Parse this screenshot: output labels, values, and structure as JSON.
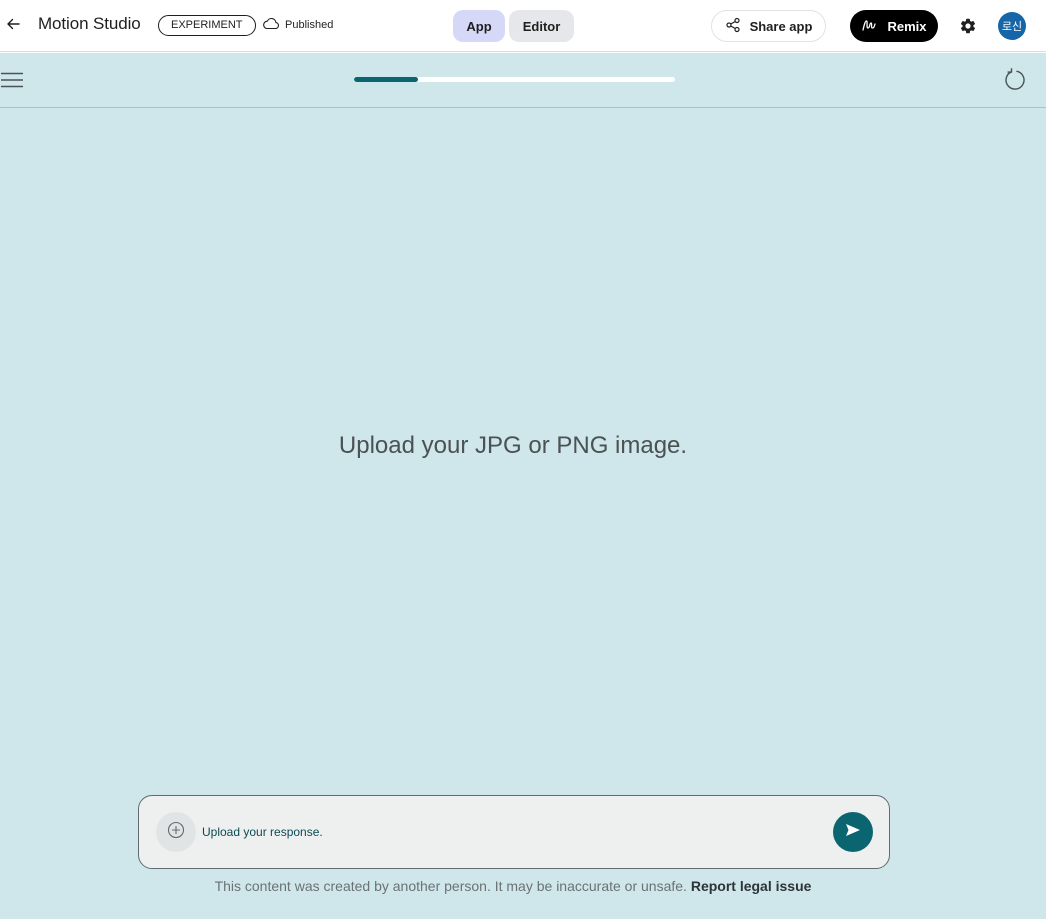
{
  "header": {
    "title": "Motion Studio",
    "badge": "EXPERIMENT",
    "status": "Published",
    "tabs": [
      {
        "label": "App",
        "active": true
      },
      {
        "label": "Editor",
        "active": false
      }
    ],
    "share_label": "Share app",
    "remix_label": "Remix",
    "avatar_initials": "로신",
    "avatar_color": "#1565a8"
  },
  "app": {
    "progress_fraction": 0.2,
    "prompt": "Upload your JPG or PNG image.",
    "accent_color": "#0b6571",
    "background_color": "#cfe6eb"
  },
  "composer": {
    "placeholder": "Upload your response."
  },
  "footer": {
    "disclaimer": "This content was created by another person. It may be inaccurate or unsafe.",
    "report_label": "Report legal issue"
  }
}
